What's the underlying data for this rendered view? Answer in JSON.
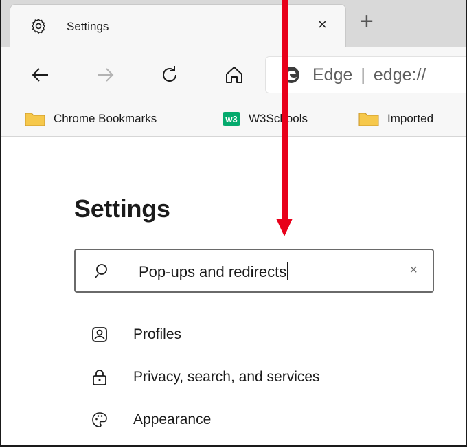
{
  "tab": {
    "icon": "gear-icon",
    "title": "Settings",
    "close_label": "×"
  },
  "new_tab_label": "+",
  "toolbar": {
    "back_icon": "back-arrow-icon",
    "forward_icon": "forward-arrow-icon",
    "refresh_icon": "refresh-icon",
    "home_icon": "home-icon"
  },
  "address": {
    "icon": "edge-logo-icon",
    "brand": "Edge",
    "separator": "|",
    "url": "edge://"
  },
  "bookmarks": [
    {
      "icon": "folder-icon",
      "label": "Chrome Bookmarks"
    },
    {
      "icon": "w3schools-icon",
      "label": "W3Schools"
    },
    {
      "icon": "folder-icon",
      "label": "Imported"
    }
  ],
  "settings": {
    "title": "Settings",
    "search": {
      "value": "Pop-ups and redirects",
      "clear_label": "×"
    },
    "menu": [
      {
        "icon": "profile-icon",
        "label": "Profiles"
      },
      {
        "icon": "lock-icon",
        "label": "Privacy, search, and services"
      },
      {
        "icon": "palette-icon",
        "label": "Appearance"
      }
    ]
  },
  "colors": {
    "annotation_arrow": "#e8001a",
    "folder": "#f6c84b",
    "w3schools": "#04aa6d",
    "tab_strip": "#d9d9d9",
    "toolbar": "#f7f7f7"
  }
}
